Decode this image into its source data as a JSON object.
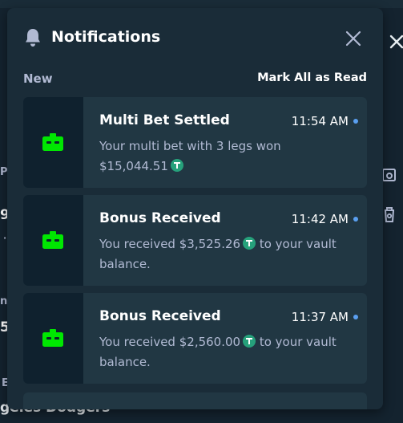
{
  "background": {
    "fragments": [
      "Pl",
      "9",
      "·",
      "n",
      "5",
      "E"
    ],
    "footer_text": "geles Dodgers"
  },
  "panel": {
    "title": "Notifications",
    "section_label": "New",
    "mark_all_label": "Mark All as Read"
  },
  "notifications": [
    {
      "title": "Multi Bet Settled",
      "time": "11:54 AM",
      "line1": "Your multi bet with 3 legs won",
      "amount": "$15,044.51",
      "suffix": "",
      "line2": "",
      "icon": "vault-icon",
      "unread": true
    },
    {
      "title": "Bonus Received",
      "time": "11:42 AM",
      "line1": "You received ",
      "amount": "$3,525.26",
      "suffix": " to your vault",
      "line2": "balance.",
      "icon": "vault-icon",
      "unread": true
    },
    {
      "title": "Bonus Received",
      "time": "11:37 AM",
      "line1": "You received ",
      "amount": "$2,560.00",
      "suffix": " to your vault",
      "line2": "balance.",
      "icon": "vault-icon",
      "unread": true
    }
  ],
  "colors": {
    "panel_bg": "#1a2c38",
    "card_bg": "#213743",
    "card_side_bg": "#0f212e",
    "icon_green": "#00e701",
    "unread_dot": "#5a9ff0",
    "usdt_green": "#26a17b"
  }
}
